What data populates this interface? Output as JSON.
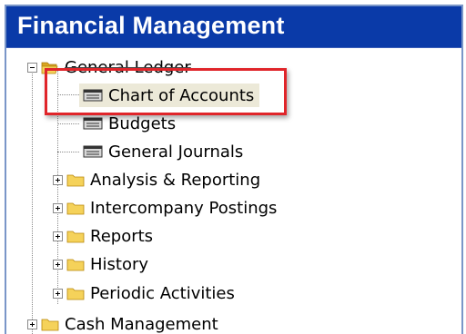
{
  "header": {
    "title": "Financial Management"
  },
  "tree": {
    "general_ledger": "General Ledger",
    "chart_of_accounts": "Chart of Accounts",
    "budgets": "Budgets",
    "general_journals": "General Journals",
    "analysis_reporting": "Analysis & Reporting",
    "intercompany_postings": "Intercompany Postings",
    "reports": "Reports",
    "history": "History",
    "periodic_activities": "Periodic Activities",
    "cash_management": "Cash Management"
  },
  "colors": {
    "header_bg": "#0a3aa8",
    "highlight": "#e0252a",
    "selected_bg": "#ece9d8",
    "folder": "#f5d25a"
  }
}
